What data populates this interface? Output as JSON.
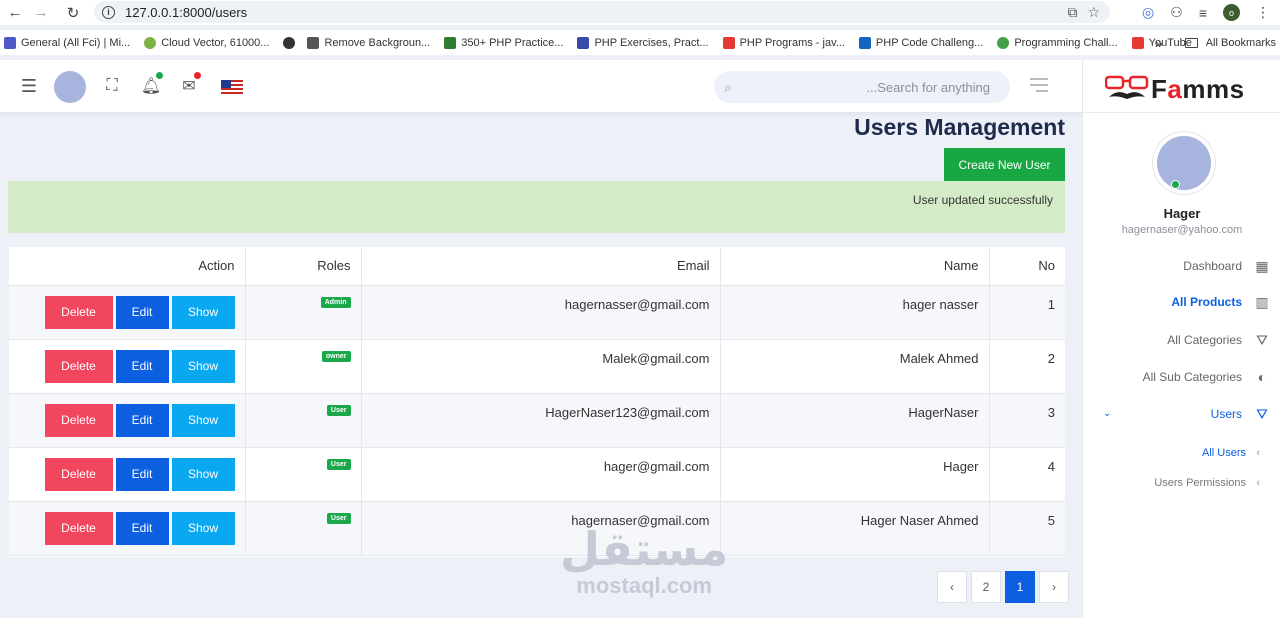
{
  "browser": {
    "url": "127.0.0.1:8000/users",
    "bookmarks": [
      {
        "label": "General (All Fci) | Mi...",
        "color": "#5059c9"
      },
      {
        "label": "Cloud Vector, 61000...",
        "color": "#7cb342"
      },
      {
        "label": "",
        "color": "#333333"
      },
      {
        "label": "Remove Backgroun...",
        "color": "#555555"
      },
      {
        "label": "350+ PHP Practice...",
        "color": "#2e7d32"
      },
      {
        "label": "PHP Exercises, Pract...",
        "color": "#3949ab"
      },
      {
        "label": "PHP Programs - jav...",
        "color": "#e53935"
      },
      {
        "label": "PHP Code Challeng...",
        "color": "#1565c0"
      },
      {
        "label": "Programming Chall...",
        "color": "#43a047"
      },
      {
        "label": "YouTube",
        "color": "#e53935"
      }
    ],
    "more_bookmarks": "»",
    "all_bookmarks": "All Bookmarks",
    "profile_initial": "o"
  },
  "header": {
    "search_placeholder": "...Search for anything"
  },
  "page": {
    "title": "Users Management",
    "create_button": "Create New User",
    "alert": "User updated successfully"
  },
  "table": {
    "columns": {
      "action": "Action",
      "roles": "Roles",
      "email": "Email",
      "name": "Name",
      "no": "No"
    },
    "buttons": {
      "delete": "Delete",
      "edit": "Edit",
      "show": "Show"
    },
    "rows": [
      {
        "no": "1",
        "name": "hager nasser",
        "email": "hagernasser@gmail.com",
        "role": "Admin"
      },
      {
        "no": "2",
        "name": "Malek Ahmed",
        "email": "Malek@gmail.com",
        "role": "owner"
      },
      {
        "no": "3",
        "name": "HagerNaser",
        "email": "HagerNaser123@gmail.com",
        "role": "User"
      },
      {
        "no": "4",
        "name": "Hager",
        "email": "hager@gmail.com",
        "role": "User"
      },
      {
        "no": "5",
        "name": "Hager Naser Ahmed",
        "email": "hagernaser@gmail.com",
        "role": "User"
      }
    ]
  },
  "pagination": {
    "prev": "‹",
    "page2": "2",
    "page1": "1",
    "next": "›"
  },
  "watermark": {
    "arabic": "مستقل",
    "latin": "mostaql.com"
  },
  "sidebar": {
    "logo_prefix": "F",
    "logo_accent": "a",
    "logo_suffix": "mms",
    "user_name": "Hager",
    "user_email": "hagernaser@yahoo.com",
    "menu": {
      "dashboard": "Dashboard",
      "all_products": "All Products",
      "all_categories": "All Categories",
      "all_sub_categories": "All Sub Categories",
      "users": "Users",
      "all_users": "All Users",
      "users_permissions": "Users Permissions"
    }
  },
  "colors": {
    "primary": "#0b5fe0",
    "success": "#19a743",
    "danger": "#f2465f",
    "info": "#0aa8f1",
    "brand_red": "#e8242a"
  }
}
